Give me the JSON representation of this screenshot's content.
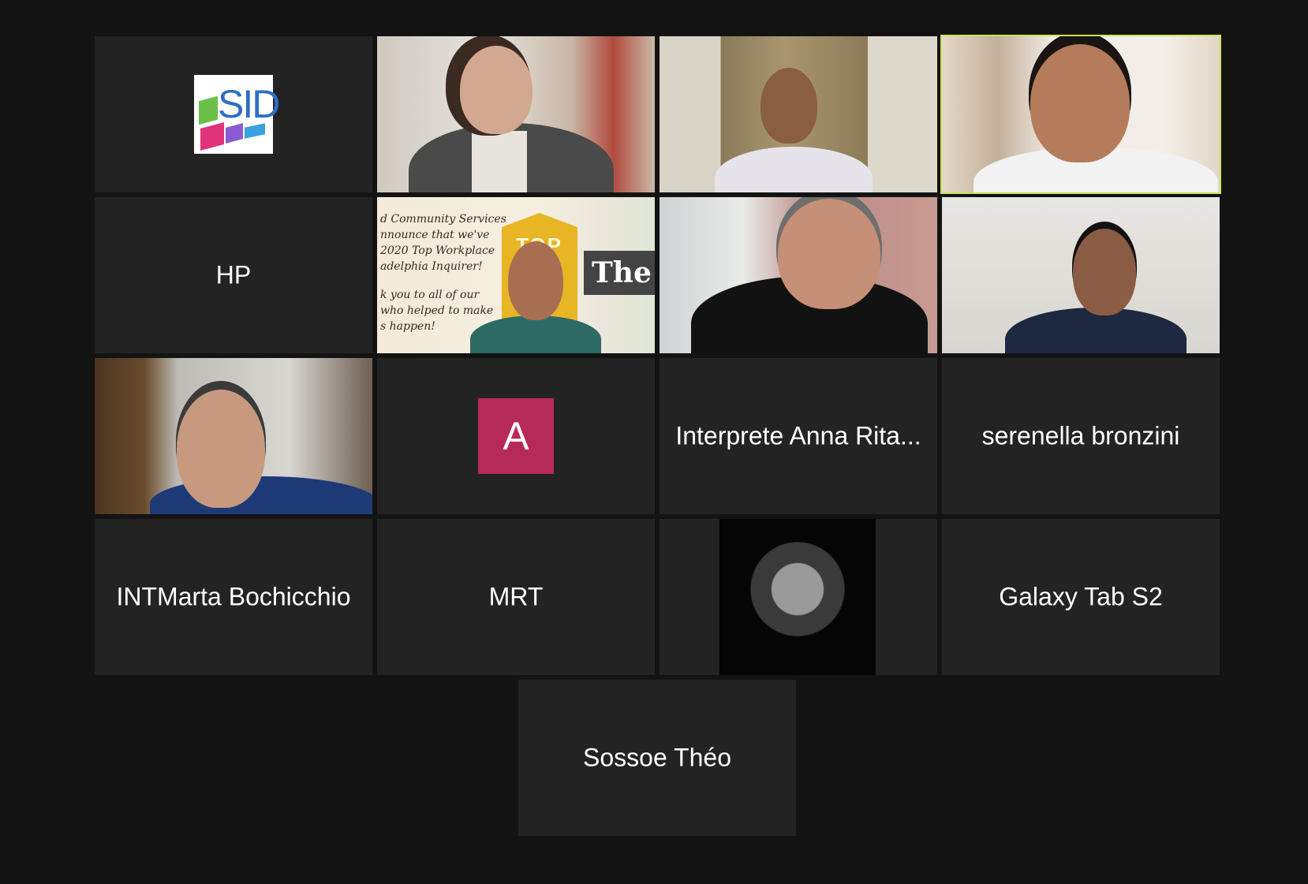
{
  "participants": [
    {
      "id": "sid",
      "type": "logo",
      "logo_text": "SID"
    },
    {
      "id": "w1",
      "type": "video"
    },
    {
      "id": "m1",
      "type": "video"
    },
    {
      "id": "m2",
      "type": "video",
      "active_speaker": true
    },
    {
      "id": "hp",
      "type": "name",
      "name": "HP"
    },
    {
      "id": "m3",
      "type": "video",
      "banner_lines": [
        "d Community Services",
        "nnounce that we've",
        " 2020 Top Workplace",
        "adelphia Inquirer!",
        "",
        "k you to all of our",
        "who helped to make",
        "s happen!"
      ],
      "newspaper_text": "The I",
      "award_text": "TOP"
    },
    {
      "id": "m4",
      "type": "video"
    },
    {
      "id": "m5",
      "type": "video"
    },
    {
      "id": "m6",
      "type": "video"
    },
    {
      "id": "a",
      "type": "avatar",
      "initial": "A",
      "avatar_color": "#b62a5a"
    },
    {
      "id": "anna",
      "type": "name",
      "name": "Interprete Anna Rita..."
    },
    {
      "id": "sere",
      "type": "name",
      "name": "serenella bronzini"
    },
    {
      "id": "marta",
      "type": "name",
      "name": "INTMarta Bochicchio"
    },
    {
      "id": "mrt",
      "type": "name",
      "name": "MRT"
    },
    {
      "id": "w2",
      "type": "photo"
    },
    {
      "id": "gal",
      "type": "name",
      "name": "Galaxy Tab S2"
    },
    {
      "id": "sos",
      "type": "name",
      "name": "Sossoe Théo"
    }
  ],
  "colors": {
    "background": "#131313",
    "tile": "#232323",
    "active_border": "#c9e35a",
    "name_text": "#ffffff"
  }
}
